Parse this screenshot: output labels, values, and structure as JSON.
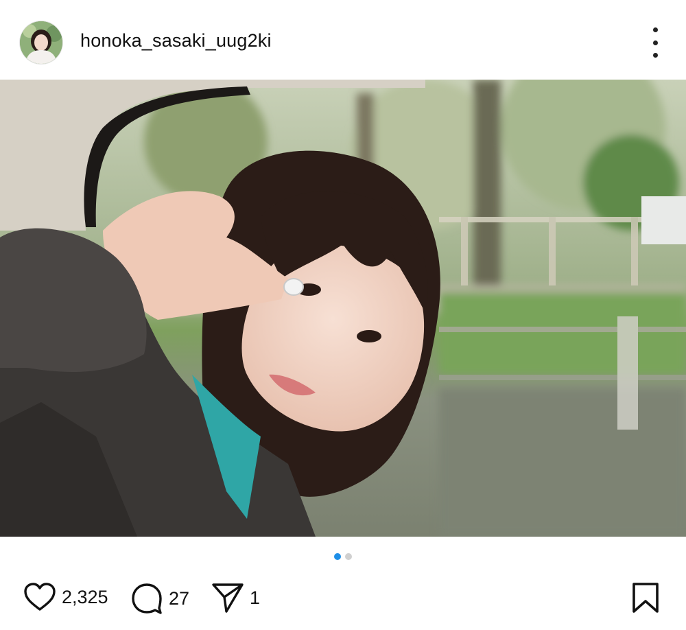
{
  "post": {
    "username": "honoka_sasaki_uug2ki",
    "avatar_icon": "profile-avatar",
    "more_icon": "more-vertical-icon",
    "image_description_icon": "photo-image",
    "carousel": {
      "total": 2,
      "active_index": 0,
      "active_color": "#1e8fe8",
      "inactive_color": "#d0d0d0"
    },
    "stats": {
      "likes": "2,325",
      "comments": "27",
      "shares": "1"
    },
    "icons": {
      "like": "heart-icon",
      "comment": "comment-icon",
      "share": "send-icon",
      "save": "bookmark-icon"
    }
  }
}
